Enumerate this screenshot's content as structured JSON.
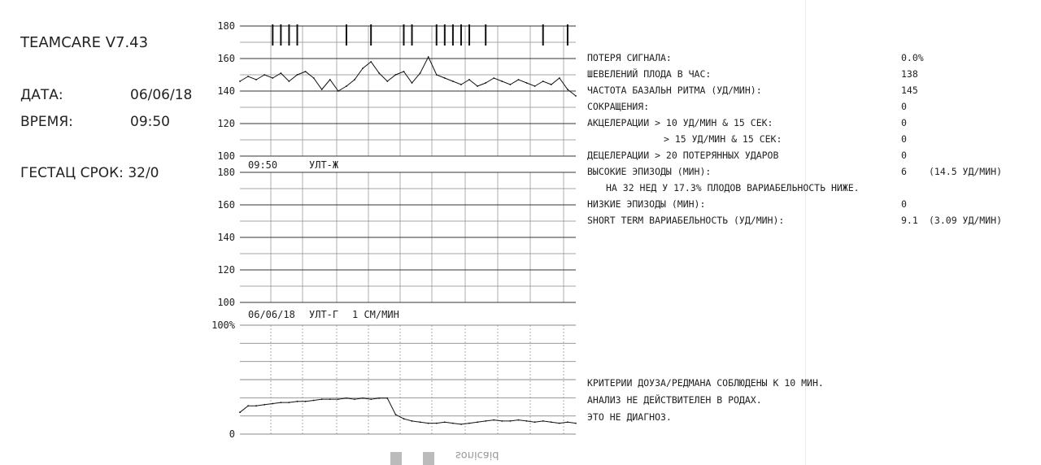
{
  "header": {
    "product": "TEAMCARE V7.43",
    "date_label": "ДАТА:",
    "date_value": "06/06/18",
    "time_label": "ВРЕМЯ:",
    "time_value": "09:50",
    "gest_label": "ГЕСТАЦ СРОК:",
    "gest_value": "32/0"
  },
  "chart_data": [
    {
      "type": "line",
      "name": "fhr_top",
      "ylim": [
        100,
        180
      ],
      "yticks": [
        "180",
        "160",
        "140",
        "120",
        "100"
      ],
      "x_minutes": [
        0,
        1,
        2,
        3,
        4,
        5,
        6,
        7,
        8,
        9,
        10,
        11,
        12,
        13,
        14,
        15,
        16,
        17,
        18,
        19,
        20,
        21,
        22,
        23,
        24,
        25,
        26,
        27,
        28,
        29,
        30,
        31,
        32,
        33,
        34,
        35,
        36,
        37,
        38,
        39,
        40,
        41
      ],
      "values": [
        146,
        149,
        147,
        150,
        148,
        151,
        146,
        150,
        152,
        148,
        141,
        147,
        140,
        143,
        147,
        154,
        158,
        151,
        146,
        150,
        152,
        145,
        151,
        161,
        150,
        148,
        146,
        144,
        147,
        143,
        145,
        148,
        146,
        144,
        147,
        145,
        143,
        146,
        144,
        148,
        141,
        137
      ],
      "movement_marks_minutes": [
        4,
        5,
        6,
        7,
        13,
        16,
        20,
        21,
        24,
        25,
        26,
        27,
        28,
        30,
        37,
        40
      ],
      "label_left": "09:50",
      "label_right": "УЛТ-Ж"
    },
    {
      "type": "line",
      "name": "fhr_bottom",
      "ylim": [
        100,
        180
      ],
      "yticks": [
        "180",
        "160",
        "140",
        "120",
        "100"
      ],
      "values": [],
      "label_left": "06/06/18",
      "label_mid": "УЛТ-Г",
      "label_right": "1 СМ/МИН"
    },
    {
      "type": "line",
      "name": "toco",
      "ylim": [
        0,
        100
      ],
      "yticks": [
        "100%",
        "0"
      ],
      "x_minutes": [
        0,
        1,
        2,
        3,
        4,
        5,
        6,
        7,
        8,
        9,
        10,
        11,
        12,
        13,
        14,
        15,
        16,
        17,
        18,
        19,
        20,
        21,
        22,
        23,
        24,
        25,
        26,
        27,
        28,
        29,
        30,
        31,
        32,
        33,
        34,
        35,
        36,
        37,
        38,
        39,
        40,
        41
      ],
      "values": [
        20,
        26,
        26,
        27,
        28,
        29,
        29,
        30,
        30,
        31,
        32,
        32,
        32,
        33,
        32,
        33,
        32,
        33,
        33,
        18,
        14,
        12,
        11,
        10,
        10,
        11,
        10,
        9,
        10,
        11,
        12,
        13,
        12,
        12,
        13,
        12,
        11,
        12,
        11,
        10,
        11,
        10
      ]
    }
  ],
  "summary": {
    "rows": [
      {
        "label": "ПОТЕРЯ СИГНАЛА:",
        "value": "0.0%",
        "extra": ""
      },
      {
        "label": "ШЕВЕЛЕНИЙ ПЛОДА В ЧАС:",
        "value": "138",
        "extra": ""
      },
      {
        "label": "ЧАСТОТА БАЗАЛЬН РИТМА (УД/МИН):",
        "value": "145",
        "extra": ""
      },
      {
        "label": "СОКРАЩЕНИЯ:",
        "value": "0",
        "extra": ""
      },
      {
        "label": "АКЦЕЛЕРАЦИИ > 10 УД/МИН & 15 СЕК:",
        "value": "0",
        "extra": ""
      },
      {
        "label": "> 15 УД/МИН & 15 СЕК:",
        "value": "0",
        "extra": ""
      },
      {
        "label": "ДЕЦЕЛЕРАЦИИ > 20 ПОТЕРЯННЫХ УДАРОВ",
        "value": "0",
        "extra": ""
      },
      {
        "label": "ВЫСОКИЕ ЭПИЗОДЫ (МИН):",
        "value": "6",
        "extra": "(14.5 УД/МИН)"
      },
      {
        "label": "НА 32 НЕД У 17.3% ПЛОДОВ ВАРИАБЕЛЬНОСТЬ НИЖЕ.",
        "value": "",
        "extra": ""
      },
      {
        "label": "НИЗКИЕ ЭПИЗОДЫ (МИН):",
        "value": "0",
        "extra": ""
      },
      {
        "label": "SHORT TERM ВАРИАБЕЛЬНОСТЬ (УД/МИН):",
        "value": "9.1",
        "extra": "(3.09 УД/МИН)"
      }
    ],
    "notes": [
      "КРИТЕРИИ ДОУЗА/РЕДМАНА СОБЛЮДЕНЫ К 10 МИН.",
      "АНАЛИЗ НЕ ДЕЙСТВИТЕЛЕН В РОДАХ.",
      "ЭТО НЕ ДИАГНОЗ."
    ]
  },
  "footer": {
    "mirrored_text": "sonicaid"
  }
}
